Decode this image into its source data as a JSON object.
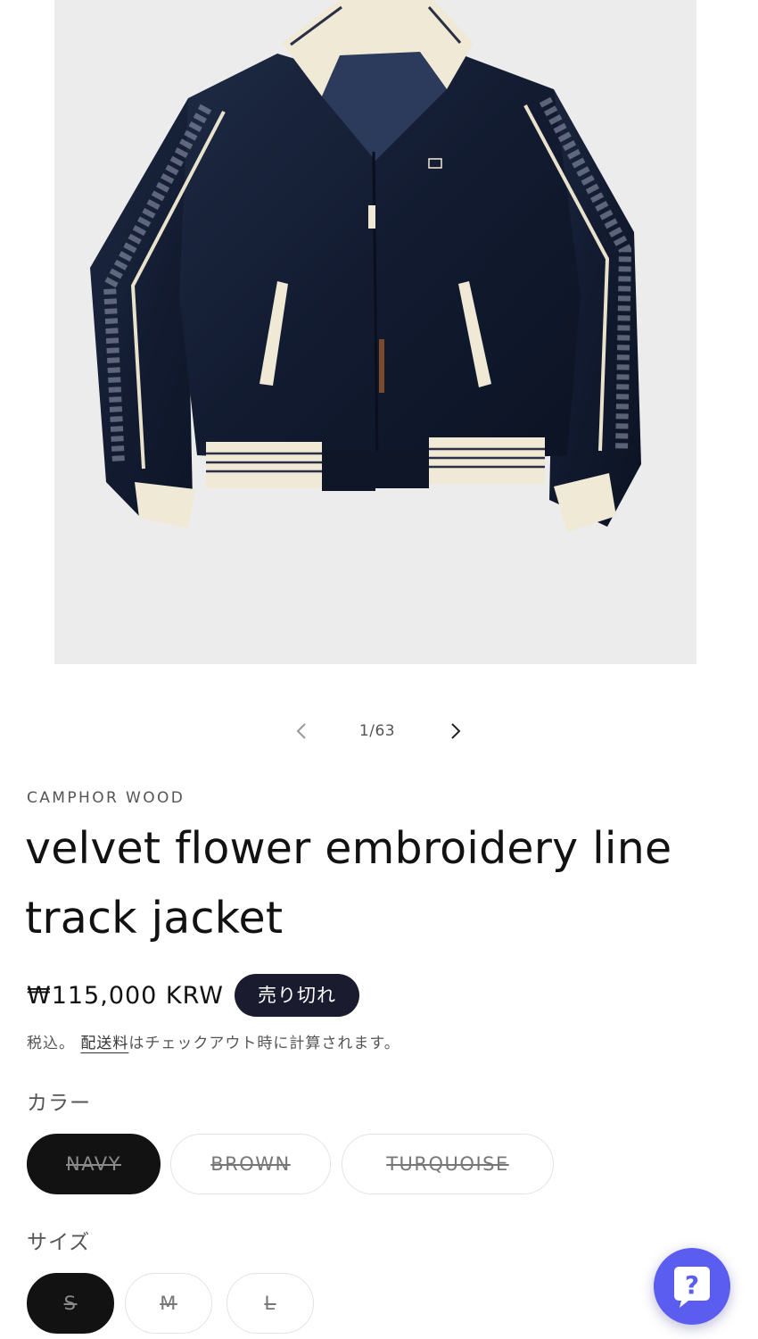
{
  "gallery": {
    "current": "1",
    "total": "63",
    "counter": "1/63",
    "background": "#ececec"
  },
  "product": {
    "vendor": "CAMPHOR WOOD",
    "title": "velvet flower embroidery line track jacket",
    "price": "₩115,000 KRW",
    "sold_out_badge": "売り切れ",
    "tax_prefix": "税込。",
    "tax_link": "配送料",
    "tax_suffix": "はチェックアウト時に計算されます。"
  },
  "color_option": {
    "label": "カラー",
    "values": [
      {
        "label": "NAVY",
        "selected": true,
        "available": false
      },
      {
        "label": "BROWN",
        "selected": false,
        "available": false
      },
      {
        "label": "TURQUOISE",
        "selected": false,
        "available": false
      }
    ]
  },
  "size_option": {
    "label": "サイズ",
    "values": [
      {
        "label": "S",
        "selected": true,
        "available": false
      },
      {
        "label": "M",
        "selected": false,
        "available": false
      },
      {
        "label": "L",
        "selected": false,
        "available": false
      }
    ]
  },
  "chat": {
    "icon": "question-mark-chat-icon",
    "color": "#5b5cf0"
  },
  "colors": {
    "badge": "#1a1b2e",
    "selected_pill": "#121212"
  }
}
